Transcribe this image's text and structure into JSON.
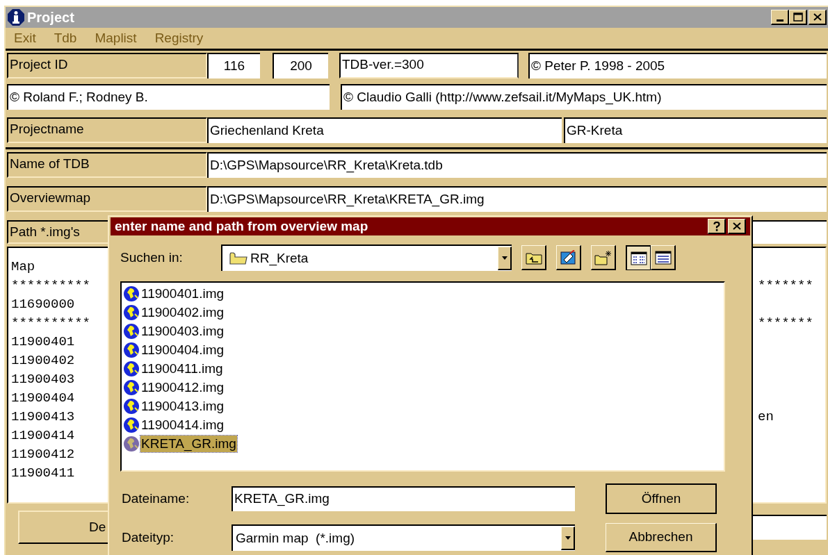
{
  "window": {
    "title": "Project"
  },
  "menu": [
    "Exit",
    "Tdb",
    "Maplist",
    "Registry"
  ],
  "project_id": {
    "label": "Project ID",
    "value_1": "116",
    "value_2": "200",
    "tdb_version": "TDB-ver.=300",
    "copyright": "© Peter P. 1998 - 2005"
  },
  "credits": [
    "© Roland F.; Rodney B.",
    "© Claudio Galli (http://www.zefsail.it/MyMaps_UK.htm)"
  ],
  "projectname": {
    "label": "Projectname",
    "value": "Griechenland Kreta",
    "short_name": "GR-Kreta"
  },
  "name_of_tdb": {
    "label": "Name of TDB",
    "value": "D:\\GPS\\Mapsource\\RR_Kreta\\Kreta.tdb"
  },
  "overviewmap": {
    "label": "Overviewmap",
    "value": "D:\\GPS\\Mapsource\\RR_Kreta\\KRETA_GR.img"
  },
  "path_imgs": {
    "label": "Path *.img's"
  },
  "map_list": {
    "lines": [
      {
        "text": "Map"
      },
      {
        "text": "**********",
        "right": "*******"
      },
      {
        "text": "11690000"
      },
      {
        "text": "**********",
        "right": "*******"
      },
      {
        "text": "11900401"
      },
      {
        "text": "11900402"
      },
      {
        "text": "11900403"
      },
      {
        "text": "11900404"
      },
      {
        "text": "11900413",
        "right": "en"
      },
      {
        "text": "11900414"
      },
      {
        "text": "11900412"
      },
      {
        "text": "11900411"
      }
    ]
  },
  "bottom_button": {
    "label": "De"
  },
  "dialog": {
    "title": "enter name and path from overview map",
    "look_in_label": "Suchen in:",
    "look_in_value": "RR_Kreta",
    "files": [
      {
        "name": "11900401.img",
        "selected": false
      },
      {
        "name": "11900402.img",
        "selected": false
      },
      {
        "name": "11900403.img",
        "selected": false
      },
      {
        "name": "11900404.img",
        "selected": false
      },
      {
        "name": "11900411.img",
        "selected": false
      },
      {
        "name": "11900412.img",
        "selected": false
      },
      {
        "name": "11900413.img",
        "selected": false
      },
      {
        "name": "11900414.img",
        "selected": false
      },
      {
        "name": "KRETA_GR.img",
        "selected": true
      }
    ],
    "filename_label": "Dateiname:",
    "filename_value": "KRETA_GR.img",
    "filetype_label": "Dateityp:",
    "filetype_value": "Garmin map  (*.img)",
    "open_button": "Öffnen",
    "cancel_button": "Abbrechen"
  }
}
